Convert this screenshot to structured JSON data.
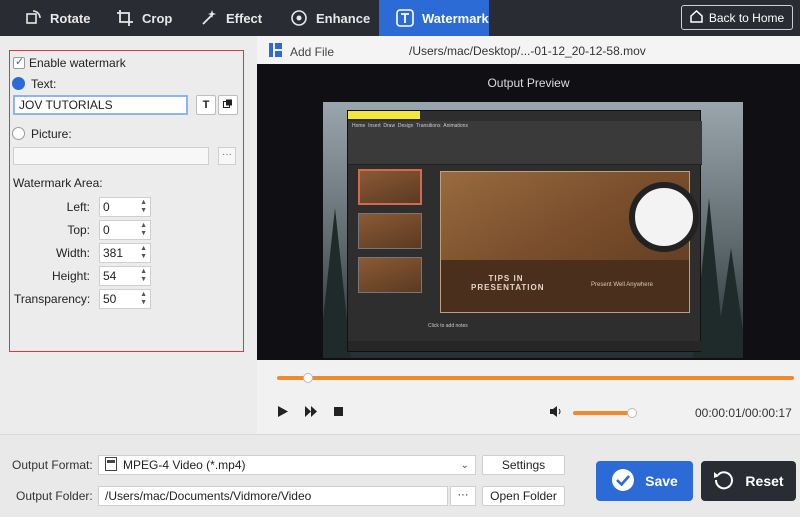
{
  "toolbar": {
    "tabs": [
      {
        "label": "Rotate",
        "icon": "rotate-icon"
      },
      {
        "label": "Crop",
        "icon": "crop-icon"
      },
      {
        "label": "Effect",
        "icon": "effect-icon"
      },
      {
        "label": "Enhance",
        "icon": "enhance-icon"
      },
      {
        "label": "Watermark",
        "icon": "watermark-icon",
        "active": true
      }
    ],
    "back_label": "Back to Home"
  },
  "watermark": {
    "enable_label": "Enable watermark",
    "enabled": true,
    "text_label": "Text:",
    "text_value": "JOV TUTORIALS",
    "text_selected": true,
    "picture_label": "Picture:",
    "picture_browse": "···",
    "area_label": "Watermark Area:",
    "fields": [
      {
        "label": "Left:",
        "value": "0"
      },
      {
        "label": "Top:",
        "value": "0"
      },
      {
        "label": "Width:",
        "value": "381"
      },
      {
        "label": "Height:",
        "value": "54"
      },
      {
        "label": "Transparency:",
        "value": "50"
      }
    ]
  },
  "file": {
    "add_label": "Add File",
    "path": "/Users/mac/Desktop/...-01-12_20-12-58.mov"
  },
  "preview": {
    "title": "Output Preview",
    "slide_title": "TIPS IN\nPRESENTATION",
    "slide_subtitle": "Present Well Anywhere",
    "notes_hint": "Click to add notes"
  },
  "playback": {
    "position_fraction": 0.06,
    "volume_fraction": 0.95,
    "timecode": "00:00:01/00:00:17"
  },
  "output": {
    "format_label": "Output Format:",
    "format_value": "MPEG-4 Video (*.mp4)",
    "settings_label": "Settings",
    "folder_label": "Output Folder:",
    "folder_value": "/Users/mac/Documents/Vidmore/Video",
    "folder_browse": "···",
    "open_folder_label": "Open Folder",
    "save_label": "Save",
    "reset_label": "Reset"
  },
  "colors": {
    "accent": "#2c6bd6",
    "toolbar_bg": "#2a2c33",
    "progress": "#f08a2a",
    "highlight_border": "#e0353a"
  }
}
